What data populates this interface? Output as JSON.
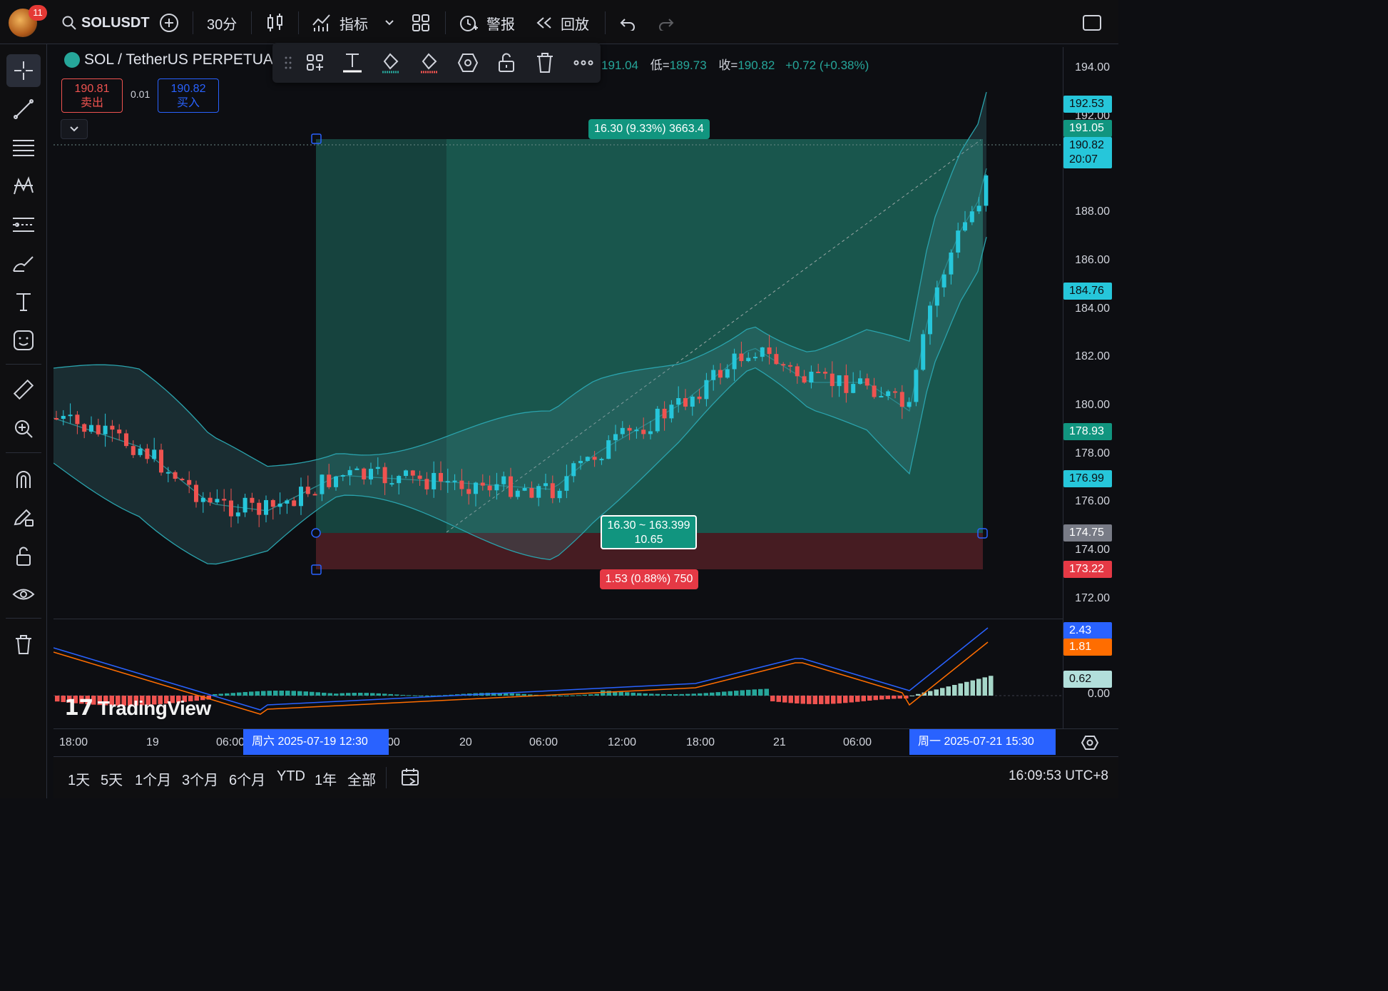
{
  "topbar": {
    "notification_count": "11",
    "symbol": "SOLUSDT",
    "interval": "30分",
    "indicators_label": "指标",
    "alerts_label": "警报",
    "replay_label": "回放"
  },
  "legend": {
    "title": "SOL / TetherUS PERPETUA",
    "ohlc_high": "191.04",
    "low_key": "低=",
    "ohlc_low": "189.73",
    "close_key": "收=",
    "ohlc_close": "190.82",
    "change": "+0.72 (+0.38%)"
  },
  "trade": {
    "sell_price": "190.81",
    "sell_label": "卖出",
    "spread": "0.01",
    "buy_price": "190.82",
    "buy_label": "买入"
  },
  "position_tool": {
    "target_label": "16.30 (9.33%) 3663.4",
    "center_line1": "16.30 ~ 163.399",
    "center_line2": "10.65",
    "stop_label": "1.53 (0.88%) 750"
  },
  "price_axis": {
    "labels": [
      "194.00",
      "192.00",
      "188.00",
      "186.00",
      "184.00",
      "182.00",
      "180.00",
      "178.00",
      "176.00",
      "174.00",
      "172.00"
    ],
    "tags": {
      "t1": "192.53",
      "t2": "191.05",
      "t3": "190.82",
      "t3_countdown": "20:07",
      "t4": "184.76",
      "t5": "178.93",
      "t6": "176.99",
      "t7": "174.75",
      "t8": "173.22"
    },
    "macd_tags": {
      "m1": "2.43",
      "m2": "1.81",
      "m3": "0.62",
      "zero": "0.00"
    }
  },
  "time_axis": {
    "labels": [
      "18:00",
      "19",
      "06:00",
      "00",
      "20",
      "06:00",
      "12:00",
      "18:00",
      "21",
      "06:00"
    ],
    "start_tag": "周六 2025-07-19   12:30",
    "end_tag": "周一  2025-07-21    15:30"
  },
  "bottombar": {
    "ranges": [
      "1天",
      "5天",
      "1个月",
      "3个月",
      "6个月",
      "YTD",
      "1年",
      "全部"
    ],
    "clock": "16:09:53 UTC+8"
  },
  "watermark": "TradingView",
  "colors": {
    "up": "#26c6da",
    "down": "#ef5350",
    "target_zone": "#1f6f62",
    "stop_zone": "#5a2128",
    "macd_line": "#2962ff",
    "signal_line": "#ff6d00"
  }
}
